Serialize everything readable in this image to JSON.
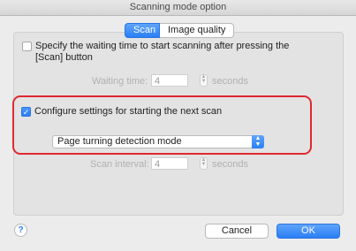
{
  "window": {
    "title": "Scanning mode option"
  },
  "tabs": [
    {
      "label": "Scan",
      "selected": true
    },
    {
      "label": "Image quality",
      "selected": false
    }
  ],
  "waiting": {
    "checkbox_line1": "Specify the waiting time to start scanning after pressing the",
    "checkbox_line2": "[Scan] button",
    "checked": false,
    "time_label": "Waiting time:",
    "time_value": "4",
    "time_unit": "seconds"
  },
  "next_scan": {
    "checkbox_label": "Configure settings for starting the next scan",
    "checked": true,
    "mode_value": "Page turning detection mode",
    "interval_label": "Scan interval:",
    "interval_value": "4",
    "interval_unit": "seconds"
  },
  "footer": {
    "help": "?",
    "cancel": "Cancel",
    "ok": "OK"
  },
  "colors": {
    "accent": "#2a7ff5",
    "highlight": "#e0282e"
  }
}
